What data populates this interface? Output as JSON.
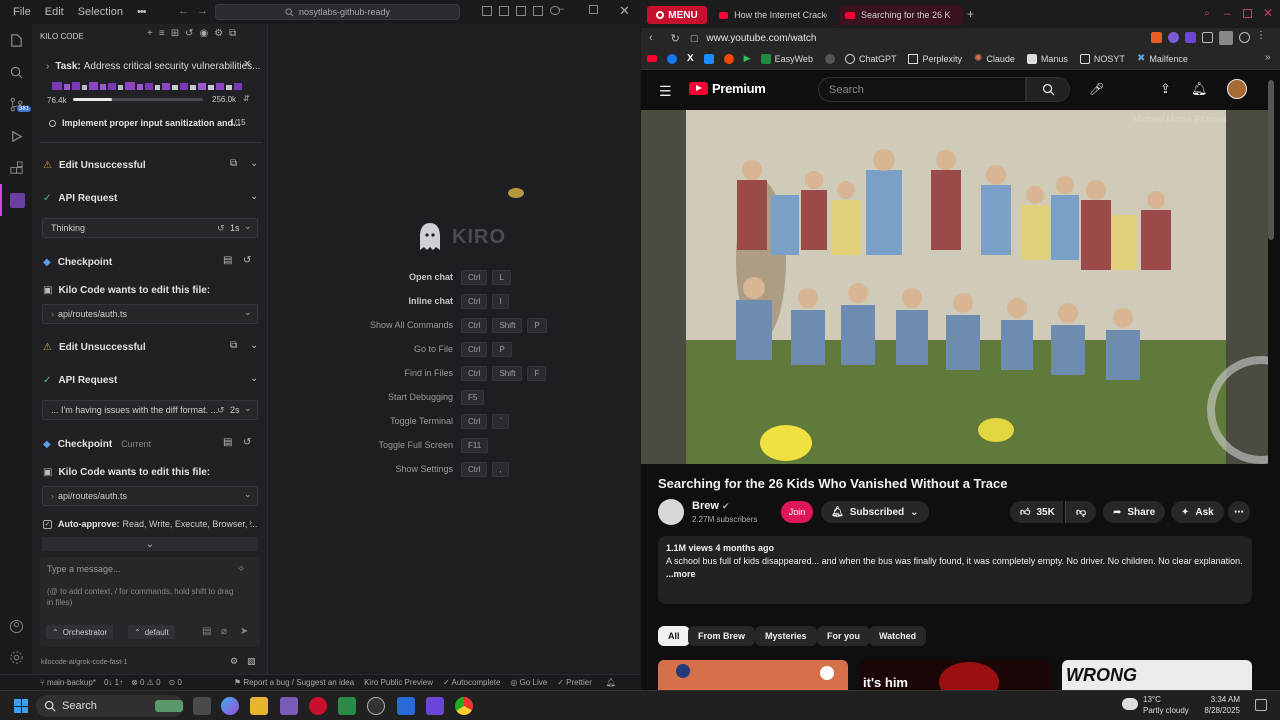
{
  "editor": {
    "menu": [
      "File",
      "Edit",
      "Selection"
    ],
    "menu_more": "•••",
    "search_text": "nosytlabs-github-ready",
    "sidebar_title": "KILO CODE",
    "task": {
      "label": "Task:",
      "text": "Address critical security vulnerabilities..."
    },
    "context": {
      "used": "76.4k",
      "max": "256.0k"
    },
    "todo": {
      "text": "Implement proper input sanitization and...",
      "count": "1/15"
    },
    "entries": {
      "edit_unsuccessful_1": "Edit Unsuccessful",
      "api_request_1": "API Request",
      "thinking": "Thinking",
      "thinking_time": "1s",
      "checkpoint_1": "Checkpoint",
      "wants_edit_1": "Kilo Code wants to edit this file:",
      "file_1": "api/routes/auth.ts",
      "edit_unsuccessful_2": "Edit Unsuccessful",
      "api_request_2": "API Request",
      "diff_msg": "... I'm having issues with the diff format. ...",
      "diff_time": "2s",
      "checkpoint_2": "Checkpoint",
      "current": "Current",
      "wants_edit_2": "Kilo Code wants to edit this file:",
      "file_2": "api/routes/auth.ts",
      "auto_approve_label": "Auto-approve:",
      "auto_approve_text": "Read, Write, Execute, Browser, ..."
    },
    "message": {
      "placeholder": "Type a message...",
      "hint": "(@ to add context, / for commands, hold shift to drag in files)",
      "mode": "Orchestrator",
      "profile": "default"
    },
    "model_line": "kilocode-ai/grok-code-fast-1",
    "brand": "KIRO",
    "shortcuts": [
      {
        "label": "Open chat",
        "keys": [
          "Ctrl",
          "L"
        ]
      },
      {
        "label": "Inline chat",
        "keys": [
          "Ctrl",
          "I"
        ]
      },
      {
        "label": "Show All Commands",
        "keys": [
          "Ctrl",
          "Shift",
          "P"
        ]
      },
      {
        "label": "Go to File",
        "keys": [
          "Ctrl",
          "P"
        ]
      },
      {
        "label": "Find in Files",
        "keys": [
          "Ctrl",
          "Shift",
          "F"
        ]
      },
      {
        "label": "Start Debugging",
        "keys": [
          "F5"
        ]
      },
      {
        "label": "Toggle Terminal",
        "keys": [
          "Ctrl",
          "`"
        ]
      },
      {
        "label": "Toggle Full Screen",
        "keys": [
          "F11"
        ]
      },
      {
        "label": "Show Settings",
        "keys": [
          "Ctrl",
          ","
        ]
      }
    ],
    "status": {
      "branch": "main-backup*",
      "sync": "0↓ 1↑",
      "problems": "⊗ 0 ⚠ 0",
      "ports": "0",
      "report": "Report a bug / Suggest an idea",
      "kiro": "Kiro Public Preview",
      "autocomplete": "Autocomplete",
      "golive": "Go Live",
      "prettier": "Prettier"
    }
  },
  "browser": {
    "menu_label": "MENU",
    "tabs": [
      "How the Internet Cracked",
      "Searching for the 26 K"
    ],
    "url": "www.youtube.com/watch",
    "bookmarks": [
      "EasyWeb",
      "ChatGPT",
      "Perplexity",
      "Claude",
      "Manus",
      "NOSYT",
      "Mailfence"
    ],
    "yt": {
      "logo": "Premium",
      "search_placeholder": "Search",
      "watermark": "Michael Morse Pictures",
      "title": "Searching for the 26 Kids Who Vanished Without a Trace",
      "channel": "Brew",
      "subscribers": "2.27M subscribers",
      "join": "Join",
      "subscribed": "Subscribed",
      "likes": "35K",
      "share": "Share",
      "ask": "Ask",
      "views": "1.1M views",
      "age": "4 months ago",
      "description": "A school bus full of kids disappeared... and when the bus was finally found, it was completely empty. No driver. No children. No clear explanation.",
      "more": "...more",
      "chips": [
        "All",
        "From Brew",
        "Mysteries",
        "For you",
        "Watched"
      ],
      "thumb_texts": [
        "it's him",
        "WRONG"
      ]
    }
  },
  "taskbar": {
    "search": "Search",
    "weather_temp": "13°C",
    "weather_desc": "Partly cloudy",
    "time": "3:34 AM",
    "date": "8/28/2025"
  },
  "colors": {
    "yt_red": "#ff0033",
    "join_pink": "#e0165c",
    "tab_active": "#3a1220",
    "accent": "#c94bd6"
  }
}
